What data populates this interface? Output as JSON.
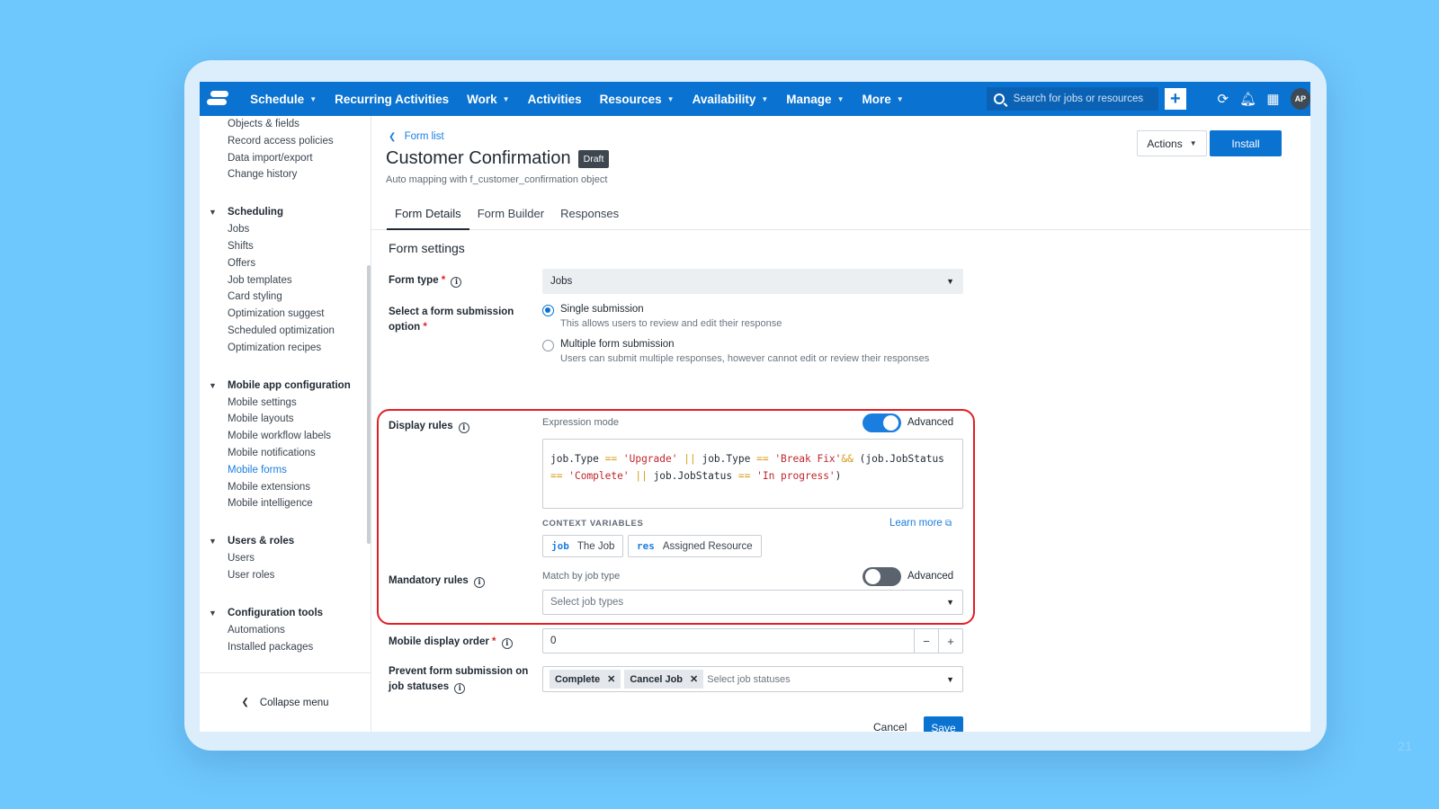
{
  "slide": {
    "page_number": "21"
  },
  "nav": {
    "items": [
      {
        "label": "Schedule",
        "dropdown": true
      },
      {
        "label": "Recurring Activities",
        "dropdown": false
      },
      {
        "label": "Work",
        "dropdown": true
      },
      {
        "label": "Activities",
        "dropdown": false
      },
      {
        "label": "Resources",
        "dropdown": true
      },
      {
        "label": "Availability",
        "dropdown": true
      },
      {
        "label": "Manage",
        "dropdown": true
      },
      {
        "label": "More",
        "dropdown": true
      }
    ],
    "search_placeholder": "Search for jobs or resources",
    "add_glyph": "+",
    "avatar_initials": "AP",
    "colors": {
      "bar": "#0a72d1",
      "accent": "#1a7ee0"
    }
  },
  "sidebar": {
    "top_links": [
      "Objects & fields",
      "Record access policies",
      "Data import/export",
      "Change history"
    ],
    "groups": [
      {
        "title": "Scheduling",
        "items": [
          "Jobs",
          "Shifts",
          "Offers",
          "Job templates",
          "Card styling",
          "Optimization suggest",
          "Scheduled optimization",
          "Optimization recipes"
        ]
      },
      {
        "title": "Mobile app configuration",
        "items": [
          "Mobile settings",
          "Mobile layouts",
          "Mobile workflow labels",
          "Mobile notifications",
          "Mobile forms",
          "Mobile extensions",
          "Mobile intelligence"
        ],
        "active": "Mobile forms"
      },
      {
        "title": "Users & roles",
        "items": [
          "Users",
          "User roles"
        ]
      },
      {
        "title": "Configuration tools",
        "items": [
          "Automations",
          "Installed packages"
        ]
      }
    ],
    "collapse_label": "Collapse menu"
  },
  "header": {
    "breadcrumb": "Form list",
    "title": "Customer Confirmation",
    "status_badge": "Draft",
    "subtitle": "Auto mapping with f_customer_confirmation object",
    "actions_label": "Actions",
    "install_label": "Install"
  },
  "tabs": [
    {
      "label": "Form Details",
      "active": true
    },
    {
      "label": "Form Builder",
      "active": false
    },
    {
      "label": "Responses",
      "active": false
    }
  ],
  "form": {
    "section_title": "Form settings",
    "form_type": {
      "label": "Form type",
      "required_mark": "*",
      "value": "Jobs"
    },
    "submission": {
      "label": "Select a form submission option",
      "required_mark": "*",
      "options": [
        {
          "label": "Single submission",
          "help": "This allows users to review and edit their response",
          "selected": true
        },
        {
          "label": "Multiple form submission",
          "help": "Users can submit multiple responses, however cannot edit or review their responses",
          "selected": false
        }
      ]
    },
    "display_rules": {
      "label": "Display rules",
      "mode_label": "Expression mode",
      "toggle_label": "Advanced",
      "toggle_on": true,
      "expression_line1": [
        {
          "t": "job.Type ",
          "k": "plain"
        },
        {
          "t": "==",
          "k": "op"
        },
        {
          "t": " ",
          "k": "plain"
        },
        {
          "t": "'Upgrade'",
          "k": "str"
        },
        {
          "t": " ",
          "k": "plain"
        },
        {
          "t": "||",
          "k": "op"
        },
        {
          "t": " job.Type ",
          "k": "plain"
        },
        {
          "t": "==",
          "k": "op"
        },
        {
          "t": " ",
          "k": "plain"
        },
        {
          "t": "'Break Fix'",
          "k": "str"
        },
        {
          "t": "&&",
          "k": "op"
        },
        {
          "t": " (job.JobStatus",
          "k": "plain"
        }
      ],
      "expression_line2": [
        {
          "t": "==",
          "k": "op"
        },
        {
          "t": " ",
          "k": "plain"
        },
        {
          "t": "'Complete'",
          "k": "str"
        },
        {
          "t": " ",
          "k": "plain"
        },
        {
          "t": "||",
          "k": "op"
        },
        {
          "t": " job.JobStatus ",
          "k": "plain"
        },
        {
          "t": "==",
          "k": "op"
        },
        {
          "t": " ",
          "k": "plain"
        },
        {
          "t": "'In progress'",
          "k": "str"
        },
        {
          "t": ")",
          "k": "plain"
        }
      ],
      "context_heading": "CONTEXT VARIABLES",
      "learn_more": "Learn more",
      "variables": [
        {
          "code": "job",
          "label": "The Job"
        },
        {
          "code": "res",
          "label": "Assigned Resource"
        }
      ]
    },
    "mandatory_rules": {
      "label": "Mandatory rules",
      "mode_label": "Match by job type",
      "toggle_label": "Advanced",
      "toggle_on": false,
      "placeholder": "Select job types"
    },
    "display_order": {
      "label": "Mobile display order",
      "required_mark": "*",
      "value": "0",
      "minus": "−",
      "plus": "+"
    },
    "prevent_submission": {
      "label": "Prevent form submission on job statuses",
      "tags": [
        "Complete",
        "Cancel Job"
      ],
      "placeholder": "Select job statuses"
    },
    "cancel_label": "Cancel",
    "save_label": "Save",
    "highlight_color": "#e11f26"
  }
}
